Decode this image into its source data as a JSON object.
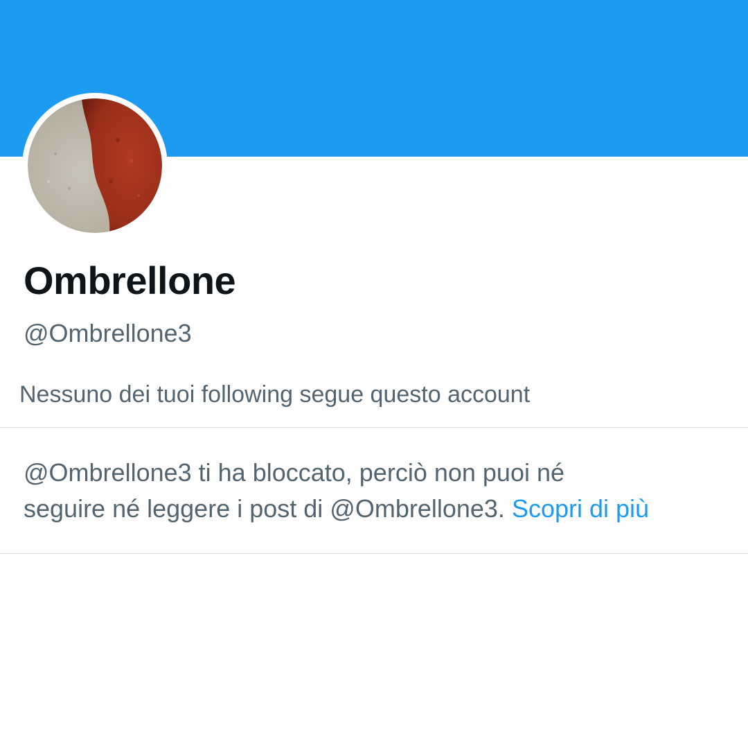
{
  "profile": {
    "display_name": "Ombrellone",
    "handle": "@Ombrellone3",
    "banner_color": "#1d9bf0",
    "avatar_icon": "avatar-photo-icon",
    "followers_note": "Nessuno dei tuoi following segue questo account"
  },
  "blocked": {
    "line1": "@Ombrellone3 ti ha bloccato, perciò non puoi né",
    "line2": "seguire né leggere i post di @Ombrellone3.",
    "link_label": "Scopri di più",
    "link_color": "#1d9bf0"
  },
  "colors": {
    "primary_text": "#0f1419",
    "secondary_text": "#536471",
    "divider": "#d9dee2"
  }
}
